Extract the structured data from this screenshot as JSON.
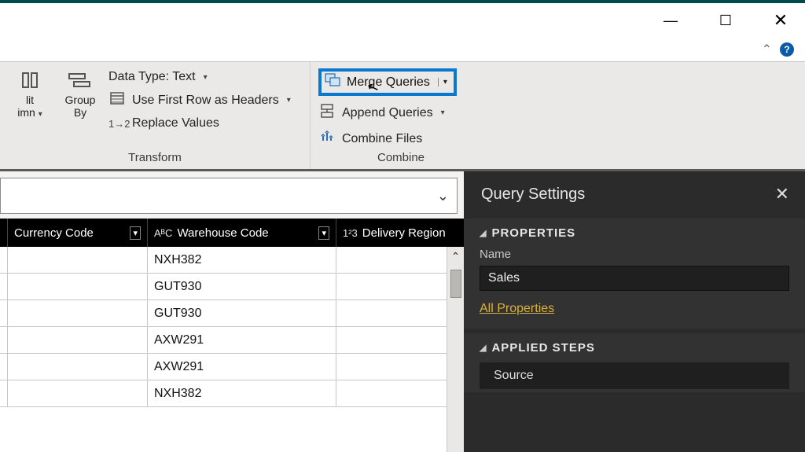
{
  "window": {
    "minimize_glyph": "—",
    "maximize_glyph": "☐",
    "close_glyph": "✕",
    "collapse_glyph": "⌃",
    "help_glyph": "?"
  },
  "ribbon": {
    "split_column": {
      "line1": "lit",
      "line2": "imn",
      "drop": "▾"
    },
    "group_by": {
      "line1": "Group",
      "line2": "By"
    },
    "data_type": {
      "label": "Data Type: Text",
      "drop": "▾"
    },
    "first_row": {
      "label": "Use First Row as Headers",
      "drop": "▾"
    },
    "replace": {
      "label": "Replace Values",
      "icon_text": "1→2"
    },
    "transform_group_label": "Transform",
    "merge": {
      "label": "Merge Queries",
      "drop": "▾"
    },
    "append": {
      "label": "Append Queries",
      "drop": "▾"
    },
    "combine_files": {
      "label": "Combine Files"
    },
    "combine_group_label": "Combine"
  },
  "formula_bar": {
    "expand_glyph": "⌄"
  },
  "table": {
    "columns": {
      "currency": {
        "label": "Currency Code",
        "type_icon": "",
        "filter": "▾"
      },
      "warehouse": {
        "label": "Warehouse Code",
        "type_icon": "AᴮC",
        "filter": "▾"
      },
      "delivery": {
        "label": "Delivery Region",
        "type_icon": "1²3",
        "filter": ""
      }
    },
    "rows": [
      {
        "currency": "",
        "warehouse": "NXH382",
        "delivery": ""
      },
      {
        "currency": "",
        "warehouse": "GUT930",
        "delivery": ""
      },
      {
        "currency": "",
        "warehouse": "GUT930",
        "delivery": ""
      },
      {
        "currency": "",
        "warehouse": "AXW291",
        "delivery": ""
      },
      {
        "currency": "",
        "warehouse": "AXW291",
        "delivery": ""
      },
      {
        "currency": "",
        "warehouse": "NXH382",
        "delivery": ""
      }
    ],
    "scroll_up": "⌃"
  },
  "query_settings": {
    "title": "Query Settings",
    "close": "✕",
    "properties_title": "PROPERTIES",
    "name_label": "Name",
    "name_value": "Sales",
    "all_properties": "All Properties",
    "applied_steps_title": "APPLIED STEPS",
    "step1": "Source",
    "tri": "◢"
  }
}
